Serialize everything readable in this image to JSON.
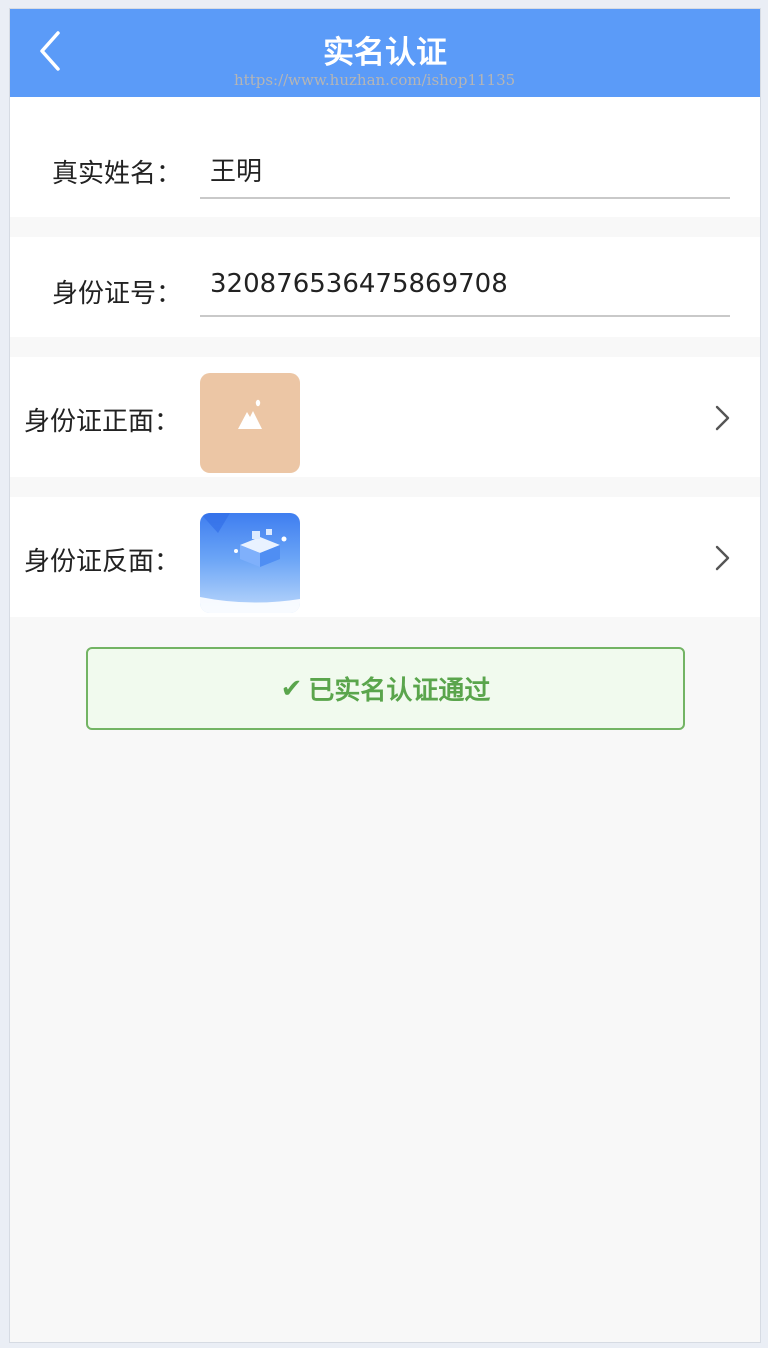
{
  "header": {
    "title": "实名认证",
    "back_icon": "chevron-left-icon"
  },
  "form": {
    "name": {
      "label": "真实姓名：",
      "value": "王明"
    },
    "id_number": {
      "label": "身份证号：",
      "value": "320876536475869708"
    },
    "id_front": {
      "label": "身份证正面：",
      "thumb_icon": "image-placeholder-icon"
    },
    "id_back": {
      "label": "身份证反面："
    }
  },
  "watermark": "https://www.huzhan.com/ishop11135",
  "status": {
    "check": "✔",
    "text": "已实名认证通过"
  },
  "colors": {
    "header_bg": "#5b9bf8",
    "status_green": "#5aa54c",
    "status_bg": "#f1faee"
  }
}
